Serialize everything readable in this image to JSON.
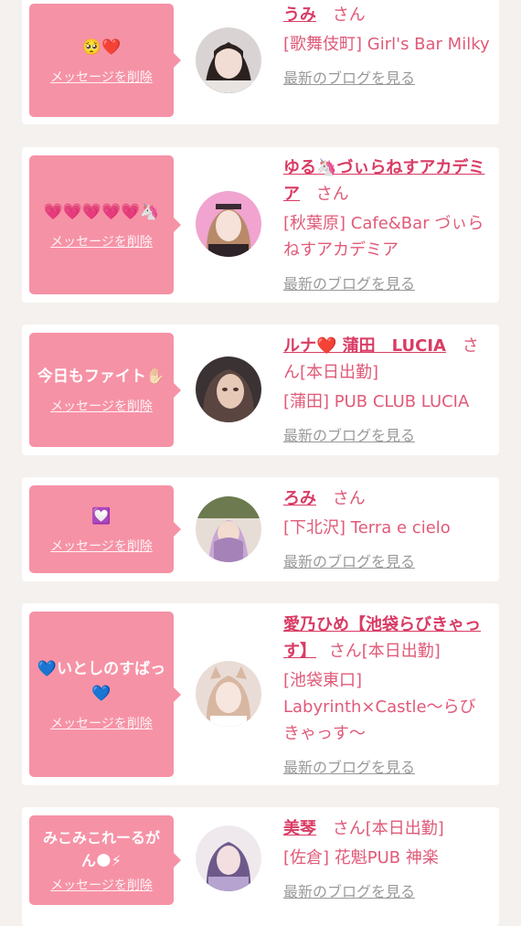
{
  "cards": [
    {
      "message": "🥺❤️",
      "delete_label": "メッセージを削除",
      "name": "うみ",
      "san": "さん",
      "shop": "[歌舞伎町] Girl's Bar Milky",
      "blog_link": "最新のブログを見る"
    },
    {
      "message": "💗💗💗💗💗🦄",
      "delete_label": "メッセージを削除",
      "name": "ゆる🦄づぃらねすアカデミア",
      "san": "さん",
      "shop": "[秋葉原] Cafe&Bar づぃらねすアカデミア",
      "blog_link": "最新のブログを見る"
    },
    {
      "message": "今日もファイト✋🏻",
      "delete_label": "メッセージを削除",
      "name": "ルナ❤️ 蒲田　LUCIA",
      "san": "さん[本日出勤]",
      "shop": "[蒲田] PUB CLUB LUCIA",
      "blog_link": "最新のブログを見る"
    },
    {
      "message": "💟",
      "delete_label": "メッセージを削除",
      "name": "ろみ",
      "san": "さん",
      "shop": "[下北沢] Terra e cielo",
      "blog_link": "最新のブログを見る"
    },
    {
      "message": "💙いとしのすばっ💙",
      "delete_label": "メッセージを削除",
      "name": "愛乃ひめ【池袋らびきゃっす】",
      "san": "さん[本日出勤]",
      "shop": "[池袋東口] Labyrinth×Castle〜らびきゃっす〜",
      "blog_link": "最新のブログを見る"
    },
    {
      "message": "みこみこれーるがん🌑⚡",
      "delete_label": "メッセージを削除",
      "name": "美琴",
      "san": "さん[本日出勤]",
      "shop": "[佐倉] 花魁PUB 神楽",
      "blog_link": "最新のブログを見る"
    }
  ]
}
